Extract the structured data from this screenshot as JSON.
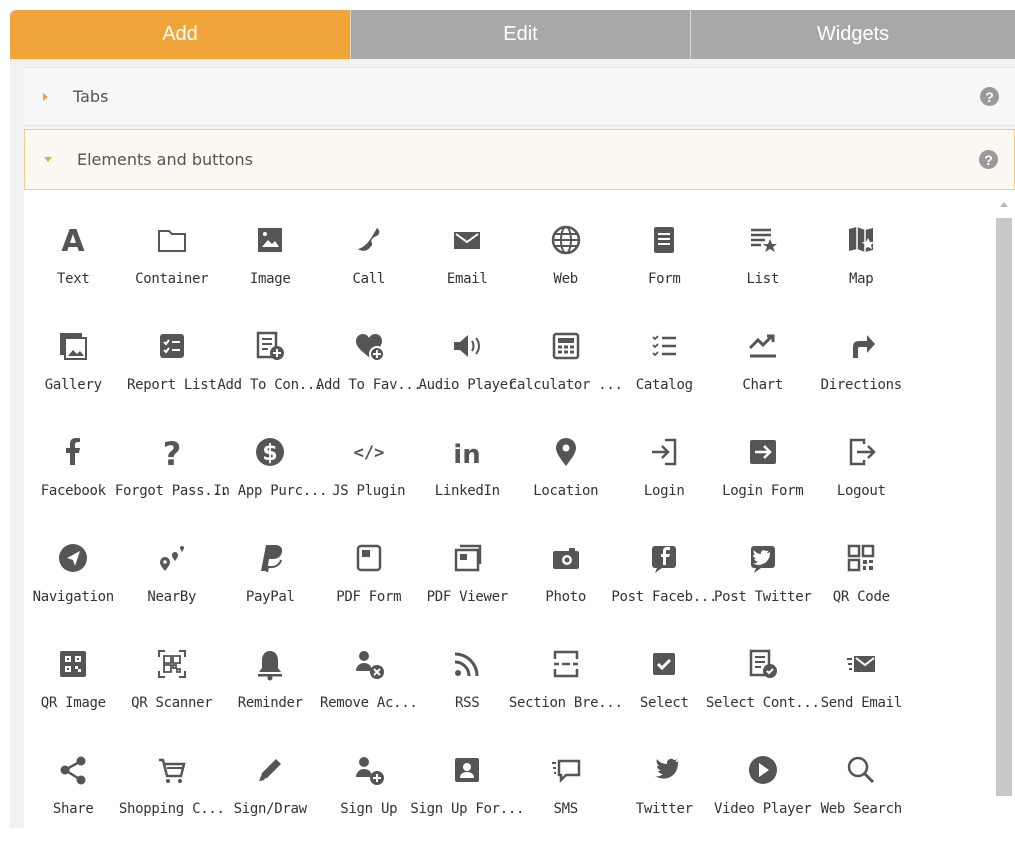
{
  "tabs": {
    "add": "Add",
    "edit": "Edit",
    "widgets": "Widgets"
  },
  "sections": {
    "tabs": "Tabs",
    "elements": "Elements and buttons",
    "help": "?"
  },
  "colors": {
    "accent": "#f0a53a",
    "tab_inactive": "#a8a8a8",
    "icon": "#555555"
  },
  "elements": [
    [
      {
        "label": "Text",
        "icon": "letter-a-icon"
      },
      {
        "label": "Container",
        "icon": "folder-icon"
      },
      {
        "label": "Image",
        "icon": "image-icon"
      },
      {
        "label": "Call",
        "icon": "phone-icon"
      },
      {
        "label": "Email",
        "icon": "envelope-icon"
      },
      {
        "label": "Web",
        "icon": "globe-icon"
      },
      {
        "label": "Form",
        "icon": "form-icon"
      },
      {
        "label": "List",
        "icon": "list-star-icon"
      },
      {
        "label": "Map",
        "icon": "map-icon"
      }
    ],
    [
      {
        "label": "Gallery",
        "icon": "gallery-icon"
      },
      {
        "label": "Report List",
        "icon": "report-list-icon"
      },
      {
        "label": "Add To Con...",
        "icon": "add-contact-icon"
      },
      {
        "label": "Add To Fav...",
        "icon": "add-favorite-icon"
      },
      {
        "label": "Audio Player",
        "icon": "speaker-icon"
      },
      {
        "label": "Calculator ...",
        "icon": "calculator-icon"
      },
      {
        "label": "Catalog",
        "icon": "catalog-icon"
      },
      {
        "label": "Chart",
        "icon": "chart-icon"
      },
      {
        "label": "Directions",
        "icon": "directions-icon"
      }
    ],
    [
      {
        "label": "Facebook",
        "icon": "facebook-icon"
      },
      {
        "label": "Forgot Pass...",
        "icon": "question-icon"
      },
      {
        "label": "In App Purc...",
        "icon": "dollar-icon"
      },
      {
        "label": "JS Plugin",
        "icon": "code-icon"
      },
      {
        "label": "LinkedIn",
        "icon": "linkedin-icon"
      },
      {
        "label": "Location",
        "icon": "location-pin-icon"
      },
      {
        "label": "Login",
        "icon": "login-icon"
      },
      {
        "label": "Login Form",
        "icon": "login-form-icon"
      },
      {
        "label": "Logout",
        "icon": "logout-icon"
      }
    ],
    [
      {
        "label": "Navigation",
        "icon": "navigation-icon"
      },
      {
        "label": "NearBy",
        "icon": "nearby-icon"
      },
      {
        "label": "PayPal",
        "icon": "paypal-icon"
      },
      {
        "label": "PDF Form",
        "icon": "pdf-form-icon"
      },
      {
        "label": "PDF Viewer",
        "icon": "pdf-viewer-icon"
      },
      {
        "label": "Photo",
        "icon": "camera-icon"
      },
      {
        "label": "Post Faceb...",
        "icon": "post-facebook-icon"
      },
      {
        "label": "Post Twitter",
        "icon": "post-twitter-icon"
      },
      {
        "label": "QR Code",
        "icon": "qr-code-icon"
      }
    ],
    [
      {
        "label": "QR Image",
        "icon": "qr-image-icon"
      },
      {
        "label": "QR Scanner",
        "icon": "qr-scanner-icon"
      },
      {
        "label": "Reminder",
        "icon": "bell-icon"
      },
      {
        "label": "Remove Ac...",
        "icon": "remove-account-icon"
      },
      {
        "label": "RSS",
        "icon": "rss-icon"
      },
      {
        "label": "Section Bre...",
        "icon": "section-break-icon"
      },
      {
        "label": "Select",
        "icon": "checkbox-icon"
      },
      {
        "label": "Select Cont...",
        "icon": "select-contact-icon"
      },
      {
        "label": "Send Email",
        "icon": "send-email-icon"
      }
    ],
    [
      {
        "label": "Share",
        "icon": "share-icon"
      },
      {
        "label": "Shopping C...",
        "icon": "cart-icon"
      },
      {
        "label": "Sign/Draw",
        "icon": "pencil-icon"
      },
      {
        "label": "Sign Up",
        "icon": "sign-up-icon"
      },
      {
        "label": "Sign Up For...",
        "icon": "sign-up-form-icon"
      },
      {
        "label": "SMS",
        "icon": "sms-icon"
      },
      {
        "label": "Twitter",
        "icon": "twitter-icon"
      },
      {
        "label": "Video Player",
        "icon": "play-icon"
      },
      {
        "label": "Web Search",
        "icon": "search-icon"
      }
    ]
  ]
}
